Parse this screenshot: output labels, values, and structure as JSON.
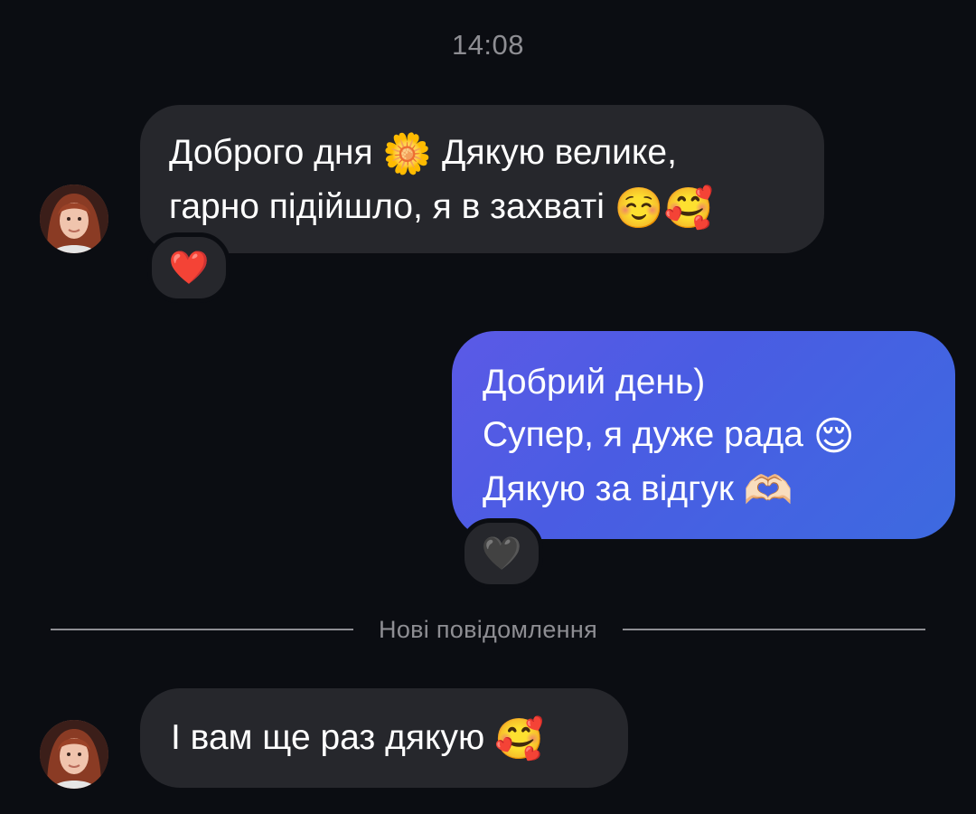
{
  "timestamp": "14:08",
  "messages": [
    {
      "direction": "incoming",
      "lines": [
        {
          "text_a": "Доброго дня ",
          "emoji_a": "🌼",
          "text_b": " Дякую велике,"
        },
        {
          "text_a": "гарно підійшло, я в захваті ",
          "emoji_a": "☺️",
          "emoji_b": "🥰"
        }
      ],
      "reaction": "❤️"
    },
    {
      "direction": "outgoing",
      "lines": [
        {
          "text_a": "Добрий день)"
        },
        {
          "text_a": "Супер, я дуже рада ",
          "emoji_a": "😌"
        },
        {
          "text_a": "Дякую за відгук ",
          "emoji_a": "🫶🏻"
        }
      ],
      "reaction": "🖤"
    },
    {
      "direction": "incoming",
      "lines": [
        {
          "text_a": "І вам ще раз дякую ",
          "emoji_a": "🥰"
        }
      ]
    }
  ],
  "divider": {
    "label": "Нові повідомлення"
  },
  "icons": {
    "avatar": "user-avatar-photo",
    "reaction_1": "red-heart-icon",
    "reaction_2": "black-heart-icon"
  },
  "colors": {
    "background": "#0b0d12",
    "incoming_bubble": "#26272c",
    "outgoing_bubble": "#4a5ce3",
    "muted_text": "#8e8e93"
  }
}
